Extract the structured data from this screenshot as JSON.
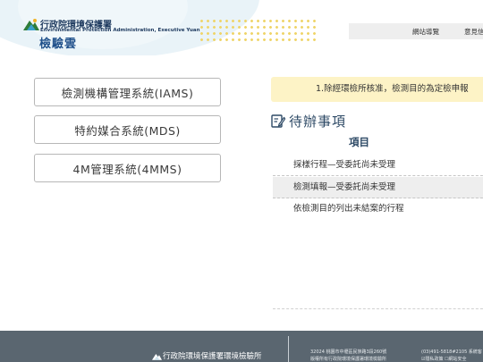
{
  "header": {
    "org_name_zh": "行政院環境保護署",
    "org_name_en": "Environmental Protection Administration, Executive Yuan",
    "site_name": "檢驗雲",
    "nav": [
      {
        "label": "網站導覽"
      },
      {
        "label": "意見信"
      }
    ]
  },
  "systems": [
    {
      "label": "檢測機構管理系統(IAMS)"
    },
    {
      "label": "特約媒合系統(MDS)"
    },
    {
      "label": "4M管理系統(4MMS)"
    }
  ],
  "notice": {
    "text": "1.除經環檢所核准，檢測目的為定檢申報"
  },
  "todo": {
    "title": "待辦事項",
    "column_header": "項目",
    "items": [
      {
        "label": "採樣行程—受委託尚未受理"
      },
      {
        "label": "檢測填報—受委託尚未受理"
      },
      {
        "label": "依檢測目的列出未結案的行程"
      }
    ]
  },
  "footer": {
    "org_name": "行政院環境保護署環境檢驗所",
    "address": "32024 桃園市中壢區民族路3段260號",
    "copyright": "版權所有行政院環境保護署環境檢驗所",
    "phone": "(03)491-5818#2105 系統客",
    "links": "☑隱私政策    ☐網站安全"
  },
  "colors": {
    "brand_blue": "#1e4f8a",
    "notice_bg": "#fdf3c6",
    "footer_bg": "#5a6670",
    "dot_yellow": "#efd56a"
  }
}
